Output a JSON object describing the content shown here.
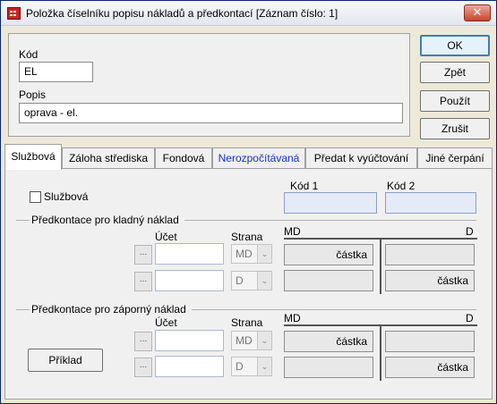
{
  "window": {
    "title": "Položka číselníku popisu nákladů a předkontací  [Záznam číslo: 1]",
    "close_glyph": "✕"
  },
  "header": {
    "kod_label": "Kód",
    "kod_value": "EL",
    "popis_label": "Popis",
    "popis_value": "oprava - el."
  },
  "buttons": {
    "ok": "OK",
    "back": "Zpět",
    "apply": "Použít",
    "cancel": "Zrušit",
    "example": "Příklad"
  },
  "tabs": [
    {
      "label": "Službová",
      "active": true
    },
    {
      "label": "Záloha střediska"
    },
    {
      "label": "Fondová"
    },
    {
      "label": "Nerozpočítávaná"
    },
    {
      "label": "Předat k vyúčtování"
    },
    {
      "label": "Jiné čerpání"
    }
  ],
  "sluzbova": {
    "checkbox_label": "Službová",
    "checked": false,
    "kod1_label": "Kód 1",
    "kod2_label": "Kód 2"
  },
  "positive": {
    "section_title": "Předkontace pro kladný náklad",
    "ucet_label": "Účet",
    "strana_label": "Strana",
    "md_label": "MD",
    "d_label": "D",
    "rows": [
      {
        "dots": "...",
        "strana": "MD",
        "md_amount": "částka",
        "d_amount": ""
      },
      {
        "dots": "...",
        "strana": "D",
        "md_amount": "",
        "d_amount": "částka"
      }
    ]
  },
  "negative": {
    "section_title": "Předkontace pro záporný náklad",
    "ucet_label": "Účet",
    "strana_label": "Strana",
    "md_label": "MD",
    "d_label": "D",
    "rows": [
      {
        "dots": "...",
        "strana": "MD",
        "md_amount": "částka",
        "d_amount": ""
      },
      {
        "dots": "...",
        "strana": "D",
        "md_amount": "",
        "d_amount": "částka"
      }
    ]
  },
  "icons": {
    "app_icon": "app-icon",
    "dropdown_arrow": "⌄"
  }
}
